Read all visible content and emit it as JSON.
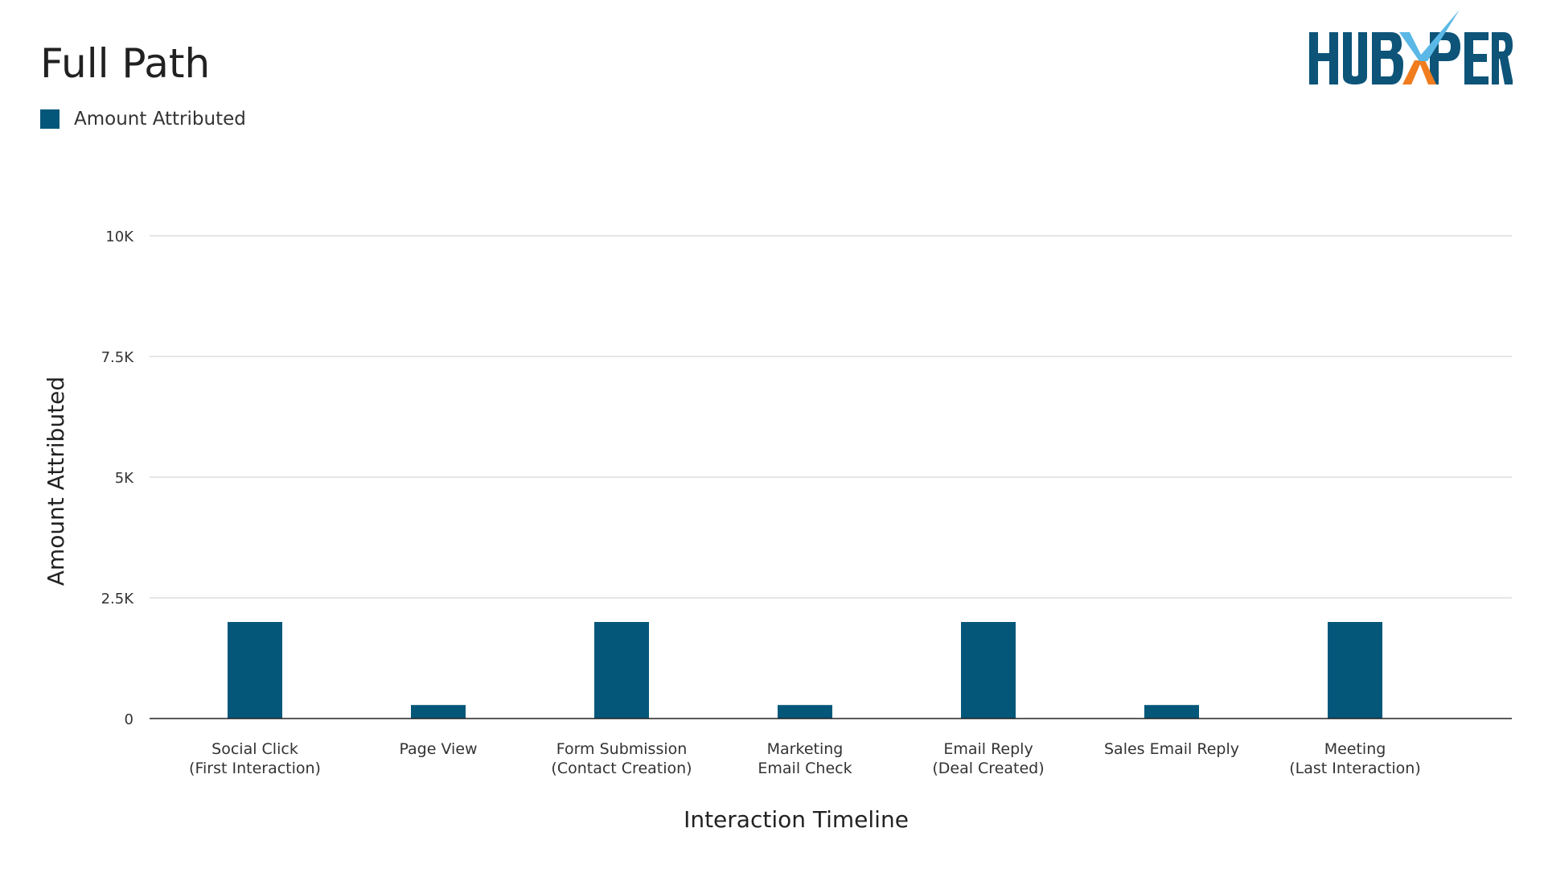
{
  "header": {
    "title": "Full Path",
    "logo_text": "HUBXPERT",
    "logo_colors": {
      "primary": "#0d5478",
      "check": "#5bb8e6",
      "accent": "#f07c1e"
    }
  },
  "legend": {
    "items": [
      {
        "label": "Amount Attributed",
        "color": "#05577a"
      }
    ],
    "position": "top-left"
  },
  "chart_data": {
    "type": "bar",
    "title": "Full Path",
    "xlabel": "Interaction Timeline",
    "ylabel": "Amount Attributed",
    "ylim": [
      0,
      10000
    ],
    "yticks": [
      0,
      2500,
      5000,
      7500,
      10000
    ],
    "ytick_labels": [
      "0",
      "2.5K",
      "5K",
      "7.5K",
      "10K"
    ],
    "grid": true,
    "categories": [
      [
        "Social Click",
        "(First Interaction)"
      ],
      [
        "Page View"
      ],
      [
        "Form Submission",
        "(Contact Creation)"
      ],
      [
        "Marketing",
        "Email Check"
      ],
      [
        "Email Reply",
        "(Deal Created)"
      ],
      [
        "Sales Email Reply"
      ],
      [
        "Meeting",
        "(Last Interaction)"
      ]
    ],
    "series": [
      {
        "name": "Amount Attributed",
        "color": "#05577a",
        "values": [
          2000,
          280,
          2000,
          280,
          2000,
          280,
          2000
        ]
      }
    ],
    "legend_position": "top-left"
  }
}
